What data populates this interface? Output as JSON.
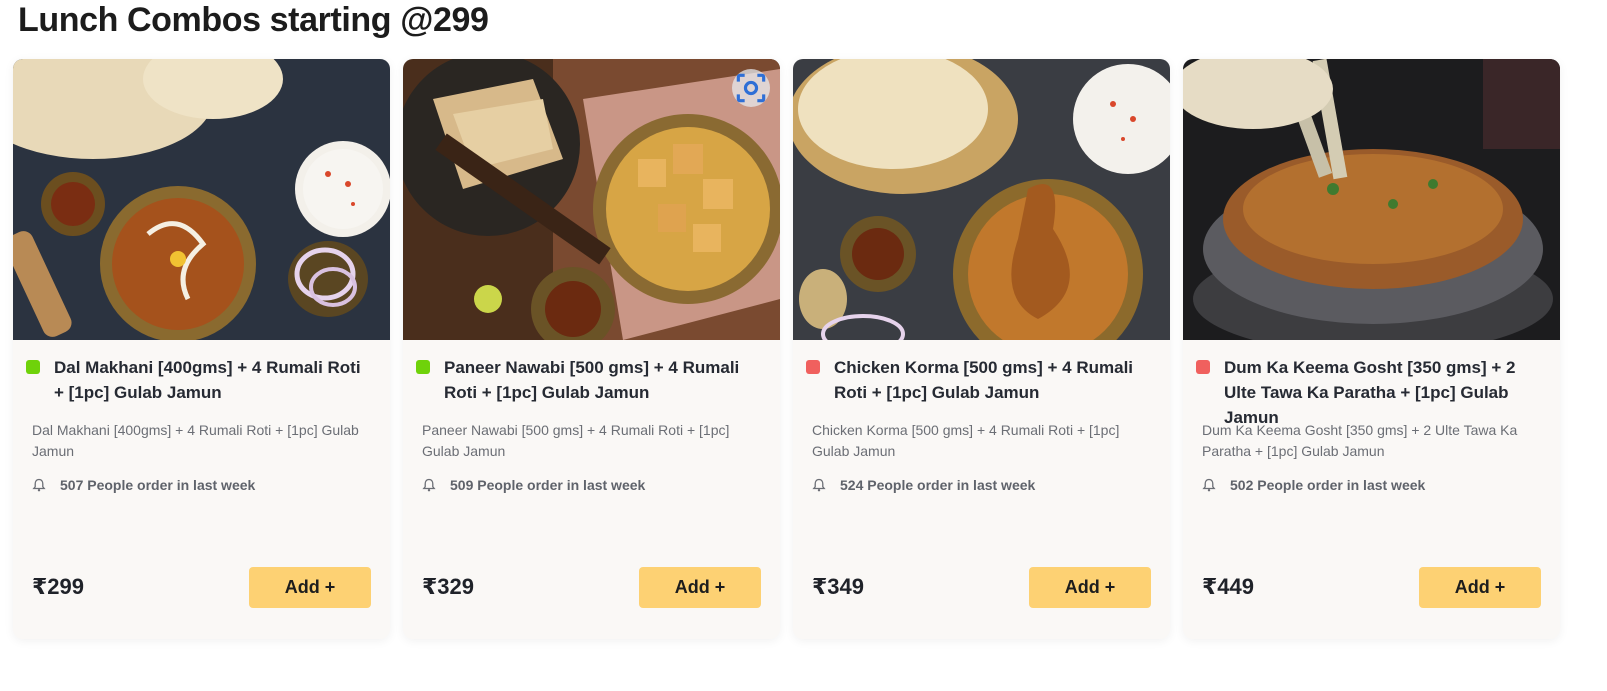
{
  "section": {
    "title": "Lunch Combos starting @299"
  },
  "colors": {
    "veg": "#6fd20a",
    "nonveg": "#f0605e",
    "add_button": "#fdd173"
  },
  "icons": {
    "image_search": "image-search-lens-icon",
    "order_badge": "bell-icon"
  },
  "cards": [
    {
      "name": "Dal Makhani [400gms] + 4 Rumali Roti + [1pc] Gulab Jamun",
      "description": "Dal Makhani [400gms] + 4 Rumali Roti + [1pc] Gulab Jamun",
      "orders": "507 People order in last week",
      "price": "₹299",
      "add_label": "Add +",
      "diet": "veg"
    },
    {
      "name": "Paneer Nawabi [500 gms] + 4 Rumali Roti + [1pc] Gulab Jamun",
      "description": "Paneer Nawabi [500 gms] + 4 Rumali Roti + [1pc] Gulab Jamun",
      "orders": "509 People order in last week",
      "price": "₹329",
      "add_label": "Add +",
      "diet": "veg"
    },
    {
      "name": "Chicken Korma [500 gms] + 4 Rumali Roti + [1pc] Gulab Jamun",
      "description": "Chicken Korma [500 gms] + 4 Rumali Roti + [1pc] Gulab Jamun",
      "orders": "524 People order in last week",
      "price": "₹349",
      "add_label": "Add +",
      "diet": "nonveg"
    },
    {
      "name": "Dum Ka Keema Gosht [350 gms] + 2 Ulte Tawa Ka Paratha + [1pc] Gulab Jamun",
      "description": "Dum Ka Keema Gosht [350 gms] + 2 Ulte Tawa Ka Paratha + [1pc] Gulab Jamun",
      "orders": "502 People order in last week",
      "price": "₹449",
      "add_label": "Add +",
      "diet": "nonveg"
    }
  ]
}
